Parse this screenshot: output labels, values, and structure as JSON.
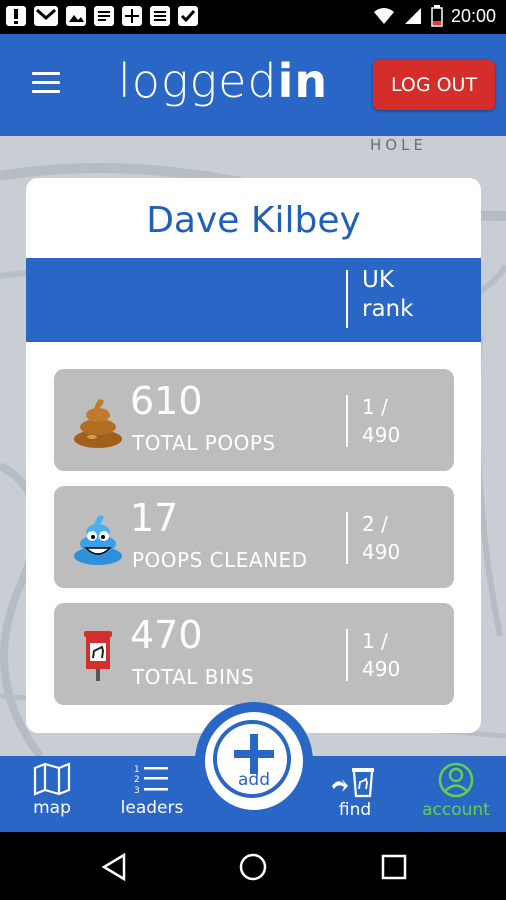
{
  "status_bar": {
    "time": "20:00"
  },
  "header": {
    "logo_light": "logged",
    "logo_bold": "in",
    "logout_label": "LOG OUT"
  },
  "map": {
    "label": "HOLE"
  },
  "profile": {
    "name": "Dave Kilbey",
    "rank_header": {
      "line1": "UK",
      "line2": "rank"
    },
    "stats": [
      {
        "value": "610",
        "label": "TOTAL POOPS",
        "rank_top": "1 /",
        "rank_bottom": "490",
        "icon": "poop-icon"
      },
      {
        "value": "17",
        "label": "POOPS CLEANED",
        "rank_top": "2 /",
        "rank_bottom": "490",
        "icon": "happy-poop-icon"
      },
      {
        "value": "470",
        "label": "TOTAL BINS",
        "rank_top": "1 /",
        "rank_bottom": "490",
        "icon": "dog-bin-icon"
      }
    ]
  },
  "bottom_nav": {
    "map": "map",
    "leaders": "leaders",
    "add": "add",
    "find": "find",
    "account": "account"
  },
  "colors": {
    "primary": "#2a66c5",
    "logout": "#d42d2a",
    "account_active": "#5fd14a",
    "stat_bg": "#bdbdbd"
  }
}
